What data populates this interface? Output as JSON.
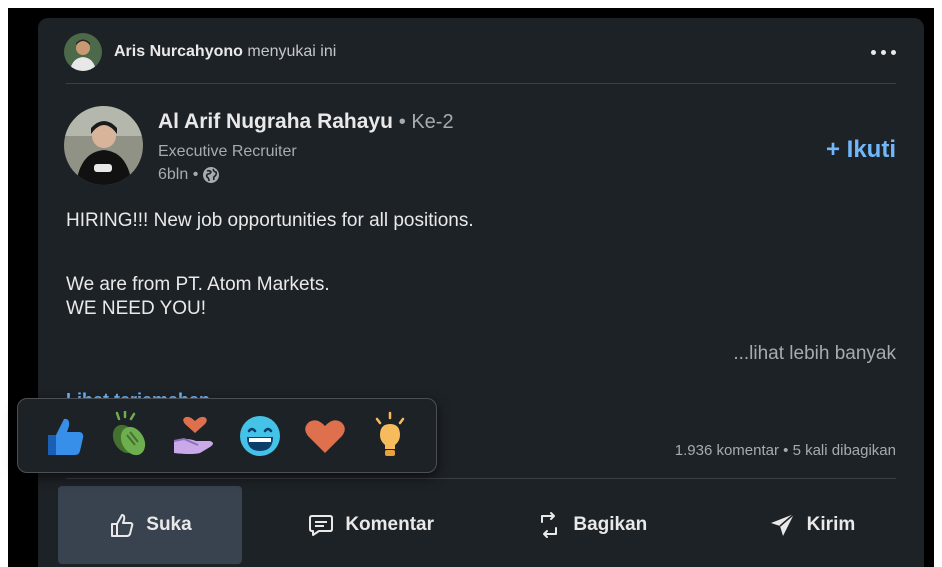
{
  "liker": {
    "name": "Aris Nurcahyono",
    "action": "menyukai ini",
    "avatar_icon": "user-avatar-photo"
  },
  "author": {
    "name": "Al Arif Nugraha Rahayu",
    "degree": "• Ke-2",
    "title": "Executive Recruiter",
    "time": "6bln •",
    "visibility_icon": "globe-icon"
  },
  "follow_label": "+ Ikuti",
  "post": {
    "line1": "HIRING!!! New job opportunities for all positions.",
    "line2": "We are from PT. Atom Markets.",
    "line3": "WE NEED YOU!",
    "see_more": "...lihat lebih banyak",
    "translate": "Lihat terjemahan"
  },
  "stats": "1.936 komentar • 5 kali dibagikan",
  "actions": [
    {
      "label": "Suka",
      "icon": "thumbs-up-outline-icon"
    },
    {
      "label": "Komentar",
      "icon": "comment-icon"
    },
    {
      "label": "Bagikan",
      "icon": "repost-icon"
    },
    {
      "label": "Kirim",
      "icon": "send-icon"
    }
  ],
  "reactions": [
    "like",
    "celebrate",
    "support",
    "funny",
    "love",
    "insightful"
  ],
  "colors": {
    "card_bg": "#1d2226",
    "link": "#71b7fb",
    "text": "#e9e9ea",
    "muted": "#a8abae"
  }
}
